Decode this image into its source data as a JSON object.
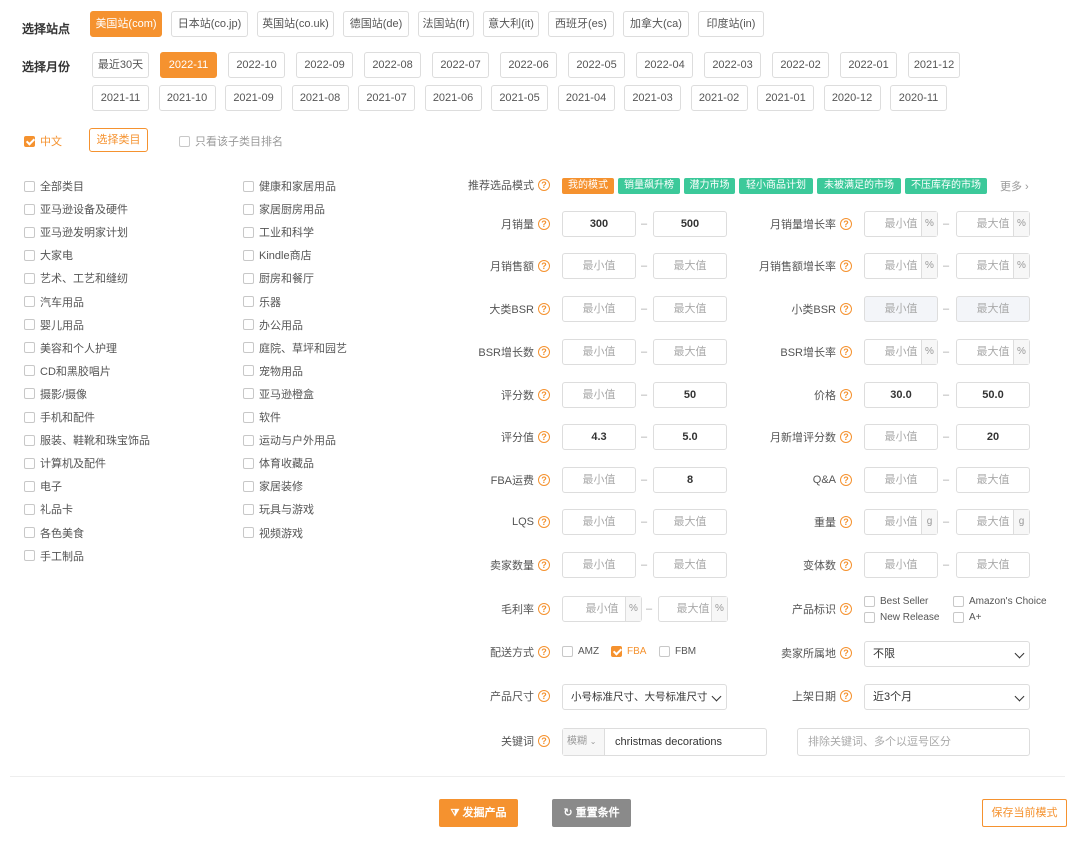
{
  "site": {
    "label": "选择站点",
    "options": [
      "美国站(com)",
      "日本站(co.jp)",
      "英国站(co.uk)",
      "德国站(de)",
      "法国站(fr)",
      "意大利(it)",
      "西班牙(es)",
      "加拿大(ca)",
      "印度站(in)"
    ],
    "selected": "美国站(com)"
  },
  "month": {
    "label": "选择月份",
    "row1": [
      "最近30天",
      "2022-11",
      "2022-10",
      "2022-09",
      "2022-08",
      "2022-07",
      "2022-06",
      "2022-05",
      "2022-04",
      "2022-03",
      "2022-02",
      "2022-01",
      "2021-12"
    ],
    "row2": [
      "2021-11",
      "2021-10",
      "2021-09",
      "2021-08",
      "2021-07",
      "2021-06",
      "2021-05",
      "2021-04",
      "2021-03",
      "2021-02",
      "2021-01",
      "2020-12",
      "2020-11"
    ],
    "selected": "2022-11"
  },
  "category_bar": {
    "chinese_label": "中文",
    "select_button": "选择类目",
    "subcategory_only": "只看该子类目排名"
  },
  "categories_col1": [
    "全部类目",
    "亚马逊设备及硬件",
    "亚马逊发明家计划",
    "大家电",
    "艺术、工艺和缝纫",
    "汽车用品",
    "婴儿用品",
    "美容和个人护理",
    "CD和黑胶唱片",
    "摄影/摄像",
    "手机和配件",
    "服装、鞋靴和珠宝饰品",
    "计算机及配件",
    "电子",
    "礼品卡",
    "各色美食",
    "手工制品"
  ],
  "categories_col2": [
    "健康和家居用品",
    "家居厨房用品",
    "工业和科学",
    "Kindle商店",
    "厨房和餐厅",
    "乐器",
    "办公用品",
    "庭院、草坪和园艺",
    "宠物用品",
    "亚马逊橙盒",
    "软件",
    "运动与户外用品",
    "体育收藏品",
    "家居装修",
    "玩具与游戏",
    "视频游戏"
  ],
  "mode": {
    "label": "推荐选品模式",
    "tags": [
      {
        "text": "我的模式",
        "color": "#f5922f"
      },
      {
        "text": "销量飙升榜",
        "color": "#3cc99a"
      },
      {
        "text": "潜力市场",
        "color": "#3cc99a"
      },
      {
        "text": "轻小商品计划",
        "color": "#3cc99a"
      },
      {
        "text": "未被满足的市场",
        "color": "#3cc99a"
      },
      {
        "text": "不压库存的市场",
        "color": "#3cc99a"
      }
    ],
    "more": "更多"
  },
  "placeholders": {
    "min": "最小值",
    "max": "最大值",
    "exclude": "排除关键词、多个以逗号区分"
  },
  "filters": {
    "monthly_sales": {
      "label": "月销量",
      "min": "300",
      "max": "500"
    },
    "monthly_sales_growth": {
      "label": "月销量增长率",
      "unit": "%"
    },
    "monthly_revenue": {
      "label": "月销售额"
    },
    "monthly_revenue_growth": {
      "label": "月销售额增长率",
      "unit": "%"
    },
    "major_bsr": {
      "label": "大类BSR"
    },
    "minor_bsr": {
      "label": "小类BSR"
    },
    "bsr_growth_count": {
      "label": "BSR增长数"
    },
    "bsr_growth_rate": {
      "label": "BSR增长率",
      "unit": "%"
    },
    "review_count": {
      "label": "评分数",
      "max": "50"
    },
    "price": {
      "label": "价格",
      "min": "30.0",
      "max": "50.0"
    },
    "rating": {
      "label": "评分值",
      "min": "4.3",
      "max": "5.0"
    },
    "monthly_new_reviews": {
      "label": "月新增评分数",
      "max": "20"
    },
    "fba_fee": {
      "label": "FBA运费",
      "max": "8"
    },
    "qa": {
      "label": "Q&A"
    },
    "lqs": {
      "label": "LQS"
    },
    "weight": {
      "label": "重量",
      "unit": "g"
    },
    "seller_count": {
      "label": "卖家数量"
    },
    "variant_count": {
      "label": "变体数"
    },
    "margin": {
      "label": "毛利率",
      "unit": "%"
    },
    "product_badge": {
      "label": "产品标识",
      "options": [
        "Best Seller",
        "Amazon's Choice",
        "New Release",
        "A+"
      ]
    },
    "shipping": {
      "label": "配送方式",
      "options": [
        "AMZ",
        "FBA",
        "FBM"
      ],
      "selected": "FBA"
    },
    "seller_location": {
      "label": "卖家所属地",
      "value": "不限"
    },
    "size": {
      "label": "产品尺寸",
      "value": "小号标准尺寸、大号标准尺寸"
    },
    "listing_date": {
      "label": "上架日期",
      "value": "近3个月"
    },
    "keyword": {
      "label": "关键词",
      "match": "模糊",
      "value": "christmas decorations"
    }
  },
  "actions": {
    "discover": "发掘产品",
    "reset": "重置条件",
    "save": "保存当前模式"
  },
  "colors": {
    "accent": "#f5922f",
    "green": "#3cc99a",
    "gray_button": "#8a8a8a"
  }
}
